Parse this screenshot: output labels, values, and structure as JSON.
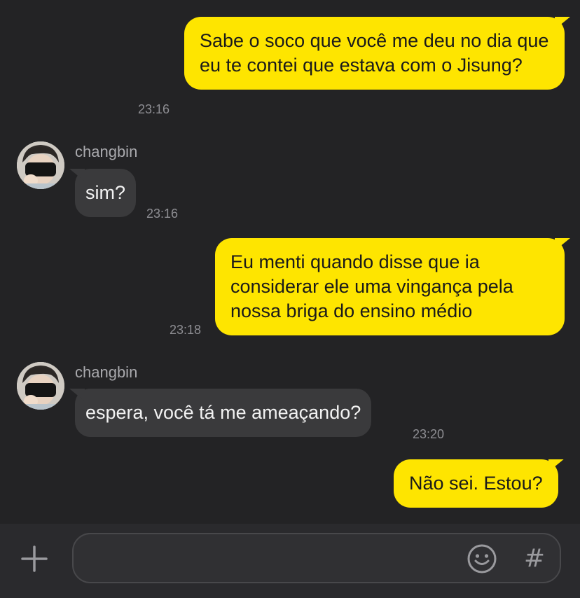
{
  "messages": [
    {
      "direction": "out",
      "text": "Sabe o soco que você me deu no dia que eu te contei que estava com o Jisung?",
      "time": "23:16"
    },
    {
      "direction": "in",
      "sender": "changbin",
      "text": "sim?",
      "time": "23:16"
    },
    {
      "direction": "out",
      "text": "Eu menti quando disse que ia considerar ele uma vingança pela nossa briga do ensino médio",
      "time": "23:18"
    },
    {
      "direction": "in",
      "sender": "changbin",
      "text": "espera, você tá me ameaçando?",
      "time": "23:20"
    },
    {
      "direction": "out",
      "text": "Não sei. Estou?",
      "time": ""
    }
  ],
  "composer": {
    "value": "",
    "left_icon": "plus-icon",
    "right_icons": [
      "emoji-icon",
      "hashtag-icon"
    ],
    "hash_glyph": "#"
  },
  "colors": {
    "background": "#232325",
    "outgoing_bubble": "#fee500",
    "incoming_bubble": "#3a3a3c",
    "timestamp": "#8e8e93"
  }
}
